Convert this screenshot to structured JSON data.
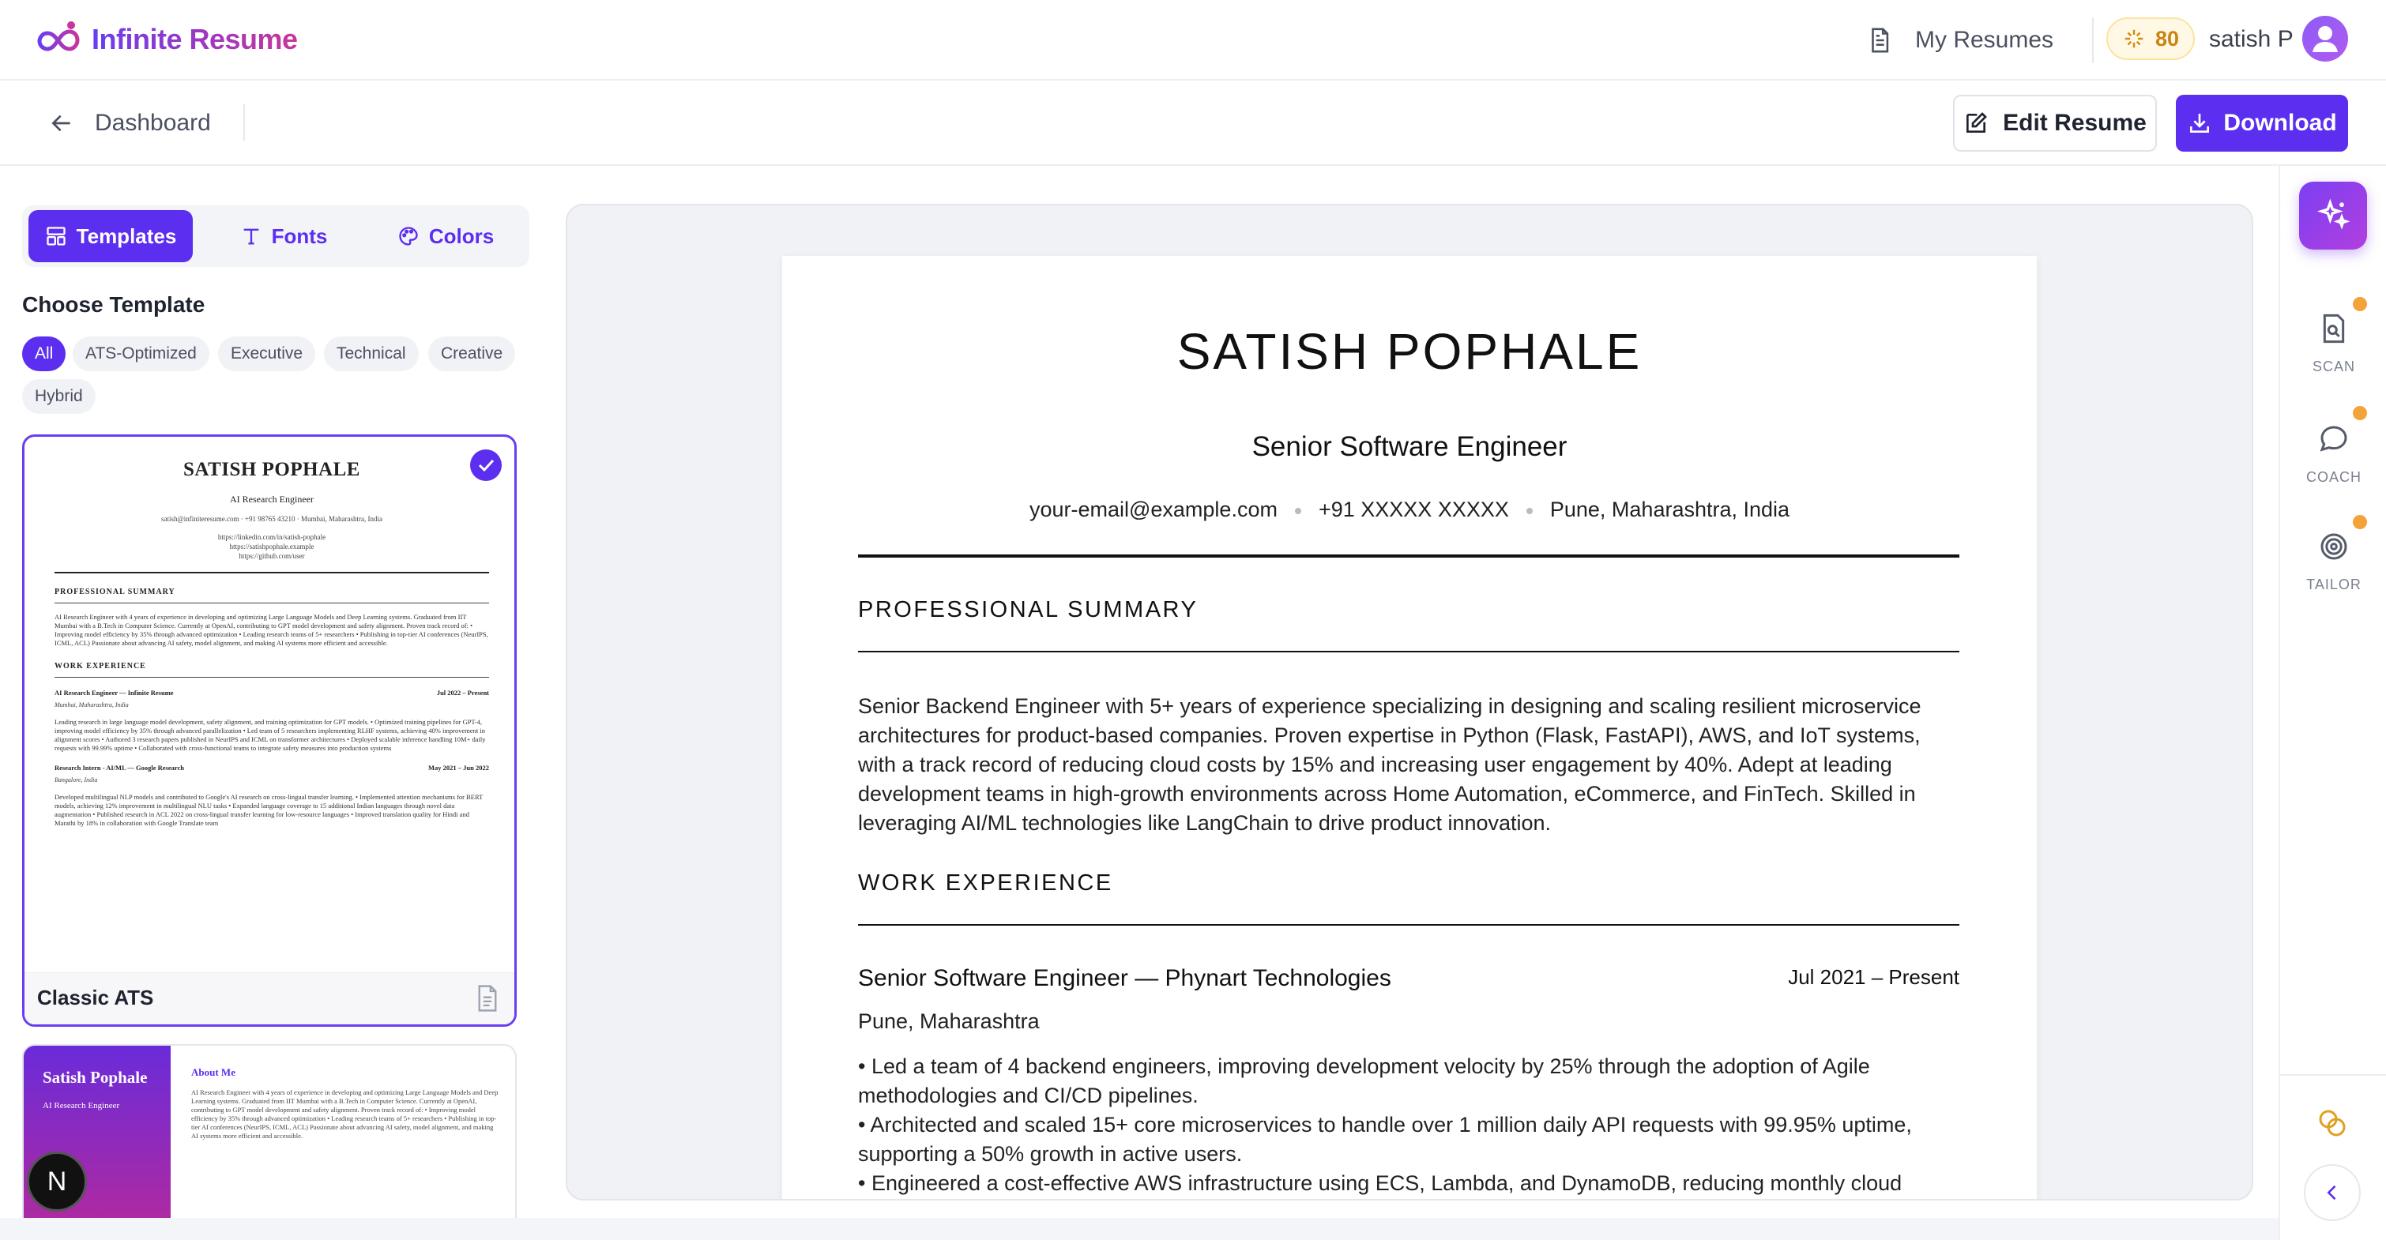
{
  "header": {
    "brand": "Infinite Resume",
    "my_resumes": "My Resumes",
    "credits": "80",
    "username": "satish P"
  },
  "subnav": {
    "back_label": "Dashboard",
    "edit_label": "Edit Resume",
    "download_label": "Download"
  },
  "sidebar": {
    "tabs": [
      "Templates",
      "Fonts",
      "Colors"
    ],
    "choose_title": "Choose Template",
    "filters": [
      "All",
      "ATS-Optimized",
      "Executive",
      "Technical",
      "Creative",
      "Hybrid"
    ],
    "selected_template": {
      "name": "Classic ATS",
      "preview": {
        "name": "SATISH POPHALE",
        "role": "AI Research Engineer",
        "contact": "satish@infiniteresume.com    ·    +91 98765 43210    ·    Mumbai, Maharashtra, India",
        "links": [
          "https://linkedin.com/in/satish-pophale",
          "https://satishpophale.example",
          "https://github.com/user"
        ],
        "summary_heading": "PROFESSIONAL SUMMARY",
        "summary_text": "AI Research Engineer with 4 years of experience in developing and optimizing Large Language Models and Deep Learning systems. Graduated from IIT Mumbai with a B.Tech in Computer Science. Currently at OpenAI, contributing to GPT model development and safety alignment. Proven track record of: • Improving model efficiency by 35% through advanced optimization • Leading research teams of 5+ researchers • Publishing in top-tier AI conferences (NeurIPS, ICML, ACL) Passionate about advancing AI safety, model alignment, and making AI systems more efficient and accessible.",
        "experience_heading": "WORK EXPERIENCE",
        "job1_title": "AI Research Engineer — Infinite Resume",
        "job1_date": "Jul 2022 – Present",
        "job1_loc": "Mumbai, Maharashtra, India",
        "job1_text": "Leading research in large language model development, safety alignment, and training optimization for GPT models. • Optimized training pipelines for GPT-4, improving model efficiency by 35% through advanced parallelization • Led team of 5 researchers implementing RLHF systems, achieving 40% improvement in alignment scores • Authored 3 research papers published in NeurIPS and ICML on transformer architectures • Deployed scalable inference handling 10M+ daily requests with 99.99% uptime • Collaborated with cross-functional teams to integrate safety measures into production systems",
        "job2_title": "Research Intern - AI/ML — Google Research",
        "job2_date": "May 2021 – Jun 2022",
        "job2_loc": "Bangalore, India",
        "job2_text": "Developed multilingual NLP models and contributed to Google's AI research on cross-lingual transfer learning. • Implemented attention mechanisms for BERT models, achieving 12% improvement in multilingual NLU tasks • Expanded language coverage to 15 additional Indian languages through novel data augmentation • Published research in ACL 2022 on cross-lingual transfer learning for low-resource languages • Improved translation quality for Hindi and Marathi by 18% in collaboration with Google Translate team"
      }
    },
    "second_template": {
      "name": "Satish Pophale",
      "role": "AI Research Engineer",
      "about_heading": "About Me",
      "about_text": "AI Research Engineer with 4 years of experience in developing and optimizing Large Language Models and Deep Learning systems. Graduated from IIT Mumbai with a B.Tech in Computer Science. Currently at OpenAI, contributing to GPT model development and safety alignment. Proven track record of: • Improving model efficiency by 35% through advanced optimization • Leading research teams of 5+ researchers • Publishing in top-tier AI conferences (NeurIPS, ICML, ACL) Passionate about advancing AI safety, model alignment, and making AI systems more efficient and accessible."
    },
    "badge": "N"
  },
  "resume": {
    "name": "SATISH POPHALE",
    "title": "Senior Software Engineer",
    "email": "your-email@example.com",
    "phone": "+91 XXXXX XXXXX",
    "location": "Pune, Maharashtra, India",
    "summary_heading": "PROFESSIONAL SUMMARY",
    "summary": "Senior Backend Engineer with 5+ years of experience specializing in designing and scaling resilient microservice architectures for product-based companies. Proven expertise in Python (Flask, FastAPI), AWS, and IoT systems, with a track record of reducing cloud costs by 15% and increasing user engagement by 40%. Adept at leading development teams in high-growth environments across Home Automation, eCommerce, and FinTech. Skilled in leveraging AI/ML technologies like LangChain to drive product innovation.",
    "experience_heading": "WORK EXPERIENCE",
    "job_title": "Senior Software Engineer — Phynart Technologies",
    "job_date": "Jul 2021 – Present",
    "job_location": "Pune, Maharashtra",
    "bullets": [
      "• Led a team of 4 backend engineers, improving development velocity by 25% through the adoption of Agile methodologies and CI/CD pipelines.",
      "• Architected and scaled 15+ core microservices to handle over 1 million daily API requests with 99.95% uptime, supporting a 50% growth in active users.",
      "• Engineered a cost-effective AWS infrastructure using ECS, Lambda, and DynamoDB, reducing monthly cloud"
    ]
  },
  "rail": {
    "scan": "SCAN",
    "coach": "COACH",
    "tailor": "TAILOR"
  },
  "colors": {
    "accent": "#5b2ef0",
    "credits_text": "#c98512",
    "notification_dot": "#f3a33a"
  }
}
